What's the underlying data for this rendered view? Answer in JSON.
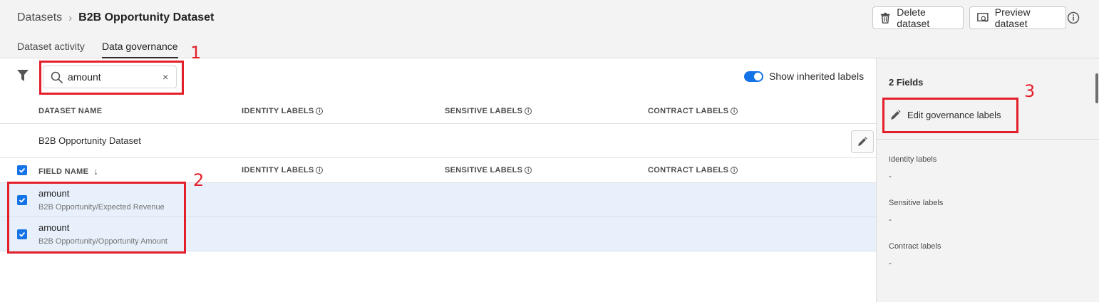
{
  "breadcrumb": {
    "parent": "Datasets",
    "separator": "›",
    "current": "B2B Opportunity Dataset"
  },
  "header": {
    "delete_label": "Delete dataset",
    "preview_label": "Preview dataset"
  },
  "tabs": [
    {
      "label": "Dataset activity",
      "active": false
    },
    {
      "label": "Data governance",
      "active": true
    }
  ],
  "toolbar": {
    "search_value": "amount",
    "clear_glyph": "×",
    "toggle_label": "Show inherited labels",
    "toggle_on": true
  },
  "dataset_table": {
    "headers": [
      "DATASET NAME",
      "IDENTITY LABELS",
      "SENSITIVE LABELS",
      "CONTRACT LABELS"
    ],
    "row_name": "B2B Opportunity Dataset"
  },
  "field_table": {
    "headers": [
      "FIELD NAME",
      "IDENTITY LABELS",
      "SENSITIVE LABELS",
      "CONTRACT LABELS"
    ],
    "sort_glyph": "↓",
    "rows": [
      {
        "name": "amount",
        "path": "B2B Opportunity/Expected Revenue",
        "checked": true
      },
      {
        "name": "amount",
        "path": "B2B Opportunity/Opportunity Amount",
        "checked": true
      }
    ]
  },
  "panel": {
    "count": "2 Fields",
    "edit_label": "Edit governance labels",
    "sections": [
      {
        "label": "Identity labels",
        "value": "-"
      },
      {
        "label": "Sensitive labels",
        "value": "-"
      },
      {
        "label": "Contract labels",
        "value": "-"
      }
    ]
  },
  "annotations": [
    "1",
    "2",
    "3"
  ],
  "colors": {
    "accent": "#1473e6",
    "annotation": "#e3202a",
    "selected_row": "#e7f0fb"
  }
}
